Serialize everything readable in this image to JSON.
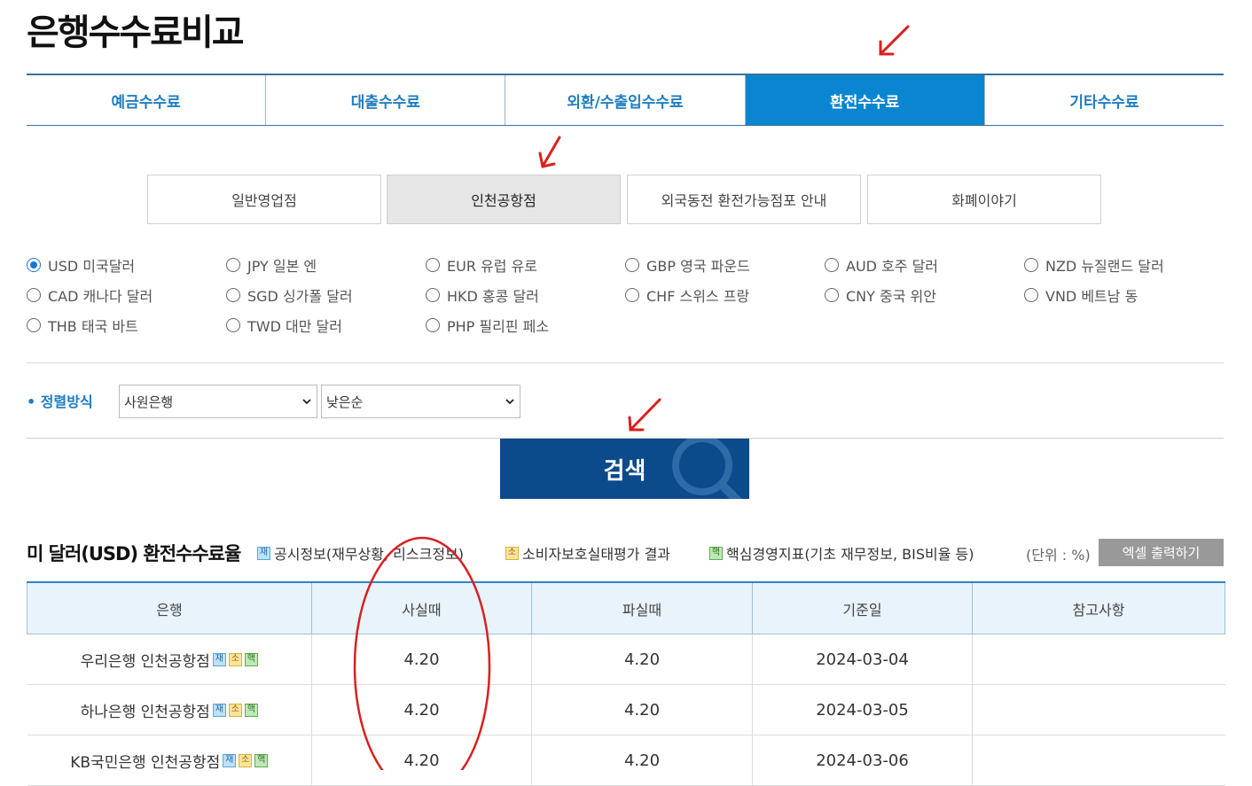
{
  "title": "은행수수료비교",
  "top_tabs": [
    {
      "label": "예금수수료",
      "active": false
    },
    {
      "label": "대출수수료",
      "active": false
    },
    {
      "label": "외환/수출입수수료",
      "active": false
    },
    {
      "label": "환전수수료",
      "active": true
    },
    {
      "label": "기타수수료",
      "active": false
    }
  ],
  "sub_tabs": [
    {
      "label": "일반영업점",
      "active": false
    },
    {
      "label": "인천공항점",
      "active": true
    },
    {
      "label": "외국동전 환전가능점포 안내",
      "active": false
    },
    {
      "label": "화폐이야기",
      "active": false
    }
  ],
  "currencies": [
    {
      "label": "USD 미국달러",
      "checked": true
    },
    {
      "label": "JPY 일본 엔",
      "checked": false
    },
    {
      "label": "EUR 유럽 유로",
      "checked": false
    },
    {
      "label": "GBP 영국 파운드",
      "checked": false
    },
    {
      "label": "AUD 호주 달러",
      "checked": false
    },
    {
      "label": "NZD 뉴질랜드 달러",
      "checked": false
    },
    {
      "label": "CAD 캐나다 달러",
      "checked": false
    },
    {
      "label": "SGD 싱가폴 달러",
      "checked": false
    },
    {
      "label": "HKD 홍콩 달러",
      "checked": false
    },
    {
      "label": "CHF 스위스 프랑",
      "checked": false
    },
    {
      "label": "CNY 중국 위안",
      "checked": false
    },
    {
      "label": "VND 베트남 동",
      "checked": false
    },
    {
      "label": "THB 태국 바트",
      "checked": false
    },
    {
      "label": "TWD 대만 달러",
      "checked": false
    },
    {
      "label": "PHP 필리핀 페소",
      "checked": false
    }
  ],
  "sort": {
    "label": "정렬방식",
    "primary_value": "사원은행",
    "secondary_value": "낮은순"
  },
  "search_label": "검색",
  "section": {
    "title": "미 달러(USD) 환전수수료율",
    "legend": [
      {
        "badge": "재",
        "text": "공시정보(재무상황, 리스크정보)"
      },
      {
        "badge": "소",
        "text": "소비자보호실태평가 결과"
      },
      {
        "badge": "핵",
        "text": "핵심경영지표(기초 재무정보, BIS비율 등)"
      }
    ],
    "unit": "(단위 : %)",
    "excel_label": "엑셀 출력하기"
  },
  "table": {
    "headers": [
      "은행",
      "사실때",
      "파실때",
      "기준일",
      "참고사항"
    ],
    "rows": [
      {
        "bank": "우리은행 인천공항점",
        "buy": "4.20",
        "sell": "4.20",
        "date": "2024-03-04",
        "note": ""
      },
      {
        "bank": "하나은행 인천공항점",
        "buy": "4.20",
        "sell": "4.20",
        "date": "2024-03-05",
        "note": ""
      },
      {
        "bank": "KB국민은행 인천공항점",
        "buy": "4.20",
        "sell": "4.20",
        "date": "2024-03-06",
        "note": ""
      }
    ],
    "badges": [
      "재",
      "소",
      "핵"
    ]
  },
  "colors": {
    "tab_active": "#0a86d0",
    "tab_text": "#1f7cc1",
    "search_button": "#0b4a8b",
    "annotation": "#d9201f"
  }
}
